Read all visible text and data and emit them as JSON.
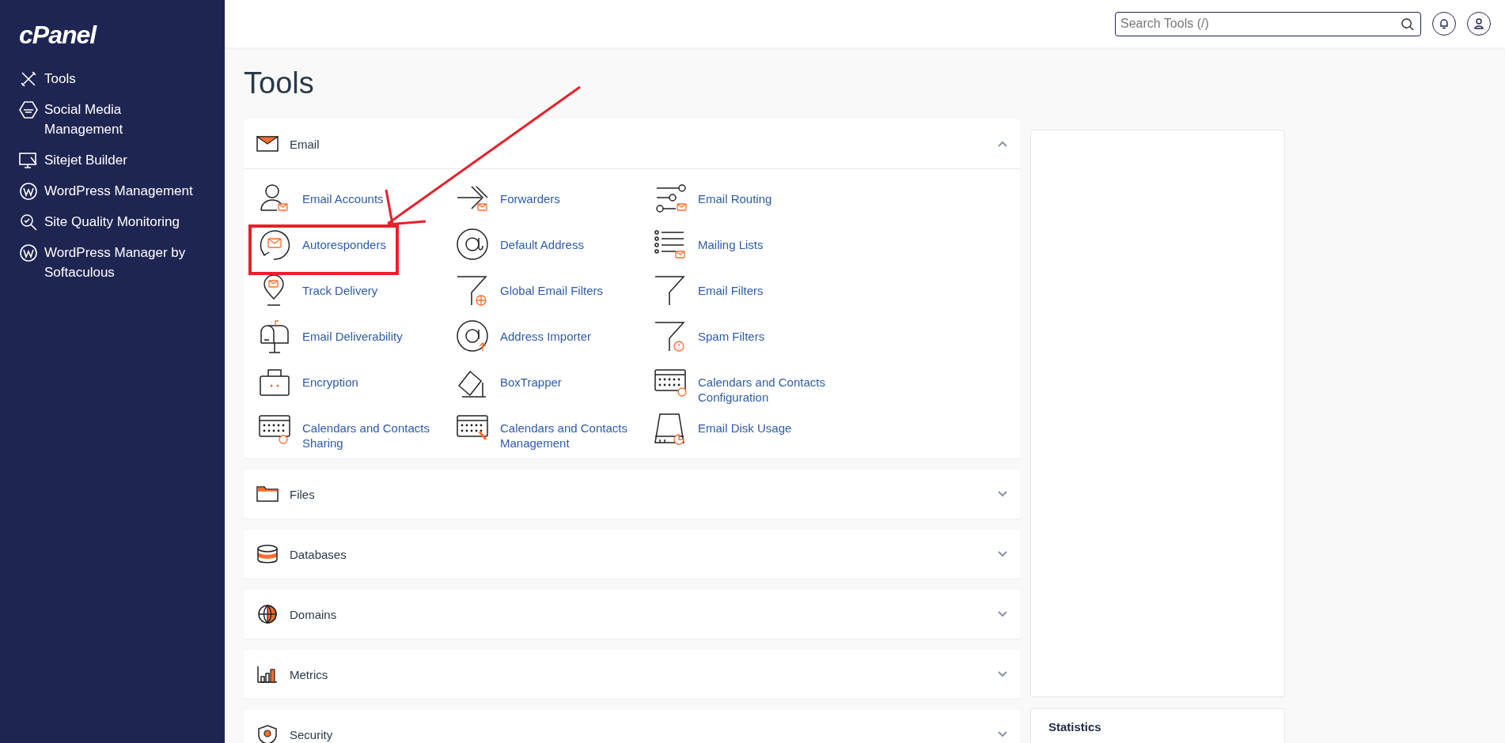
{
  "sidebar": {
    "logo": "cPanel",
    "items": [
      {
        "label": "Tools"
      },
      {
        "label": "Social Media Management"
      },
      {
        "label": "Sitejet Builder"
      },
      {
        "label": "WordPress Management"
      },
      {
        "label": "Site Quality Monitoring"
      },
      {
        "label": "WordPress Manager by Softaculous"
      }
    ]
  },
  "header": {
    "search": {
      "placeholder": "Search Tools (/)"
    }
  },
  "page": {
    "title": "Tools"
  },
  "sections": [
    {
      "title": "Email",
      "expanded": true,
      "tools": [
        {
          "label": "Email Accounts"
        },
        {
          "label": "Forwarders"
        },
        {
          "label": "Email Routing"
        },
        {
          "label": "Autoresponders"
        },
        {
          "label": "Default Address"
        },
        {
          "label": "Mailing Lists"
        },
        {
          "label": "Track Delivery"
        },
        {
          "label": "Global Email Filters"
        },
        {
          "label": "Email Filters"
        },
        {
          "label": "Email Deliverability"
        },
        {
          "label": "Address Importer"
        },
        {
          "label": "Spam Filters"
        },
        {
          "label": "Encryption"
        },
        {
          "label": "BoxTrapper"
        },
        {
          "label": "Calendars and Contacts Configuration"
        },
        {
          "label": "Calendars and Contacts Sharing"
        },
        {
          "label": "Calendars and Contacts Management"
        },
        {
          "label": "Email Disk Usage"
        }
      ]
    },
    {
      "title": "Files",
      "expanded": false
    },
    {
      "title": "Databases",
      "expanded": false
    },
    {
      "title": "Domains",
      "expanded": false
    },
    {
      "title": "Metrics",
      "expanded": false
    },
    {
      "title": "Security",
      "expanded": false
    }
  ],
  "side_panel": {
    "statistics_title": "Statistics"
  }
}
